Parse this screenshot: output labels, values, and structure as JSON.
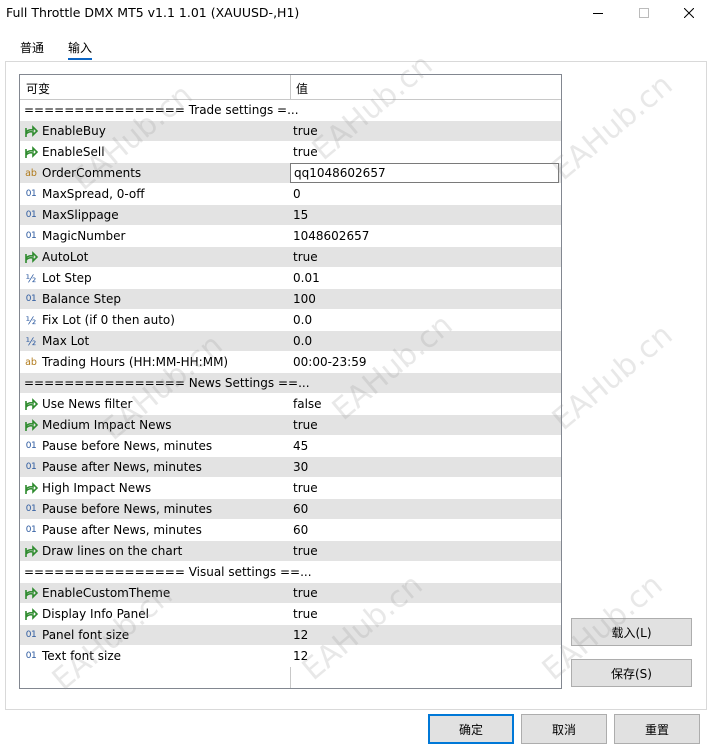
{
  "window": {
    "title": "Full Throttle DMX MT5 v1.1 1.01 (XAUUSD-,H1)",
    "minimize_icon": "minimize-icon",
    "maximize_icon": "maximize-icon",
    "close_icon": "close-icon"
  },
  "tabs": [
    {
      "label": "普通",
      "active": false
    },
    {
      "label": "输入",
      "active": true
    }
  ],
  "grid": {
    "col_variable": "可变",
    "col_value": "值",
    "rows": [
      {
        "type": "sep",
        "name": "================ Trade settings =..."
      },
      {
        "type": "bool",
        "icon": "arrow-icon",
        "name": "EnableBuy",
        "value": "true"
      },
      {
        "type": "bool",
        "icon": "arrow-icon",
        "name": "EnableSell",
        "value": "true"
      },
      {
        "type": "string",
        "icon": "ab-icon",
        "name": "OrderComments",
        "value": "qq1048602657",
        "editing": true
      },
      {
        "type": "int",
        "icon": "int-icon",
        "name": "MaxSpread, 0-off",
        "value": "0"
      },
      {
        "type": "int",
        "icon": "int-icon",
        "name": "MaxSlippage",
        "value": "15"
      },
      {
        "type": "int",
        "icon": "int-icon",
        "name": "MagicNumber",
        "value": "1048602657"
      },
      {
        "type": "bool",
        "icon": "arrow-icon",
        "name": "AutoLot",
        "value": "true"
      },
      {
        "type": "double",
        "icon": "fraction-icon",
        "name": "Lot Step",
        "value": "0.01"
      },
      {
        "type": "int",
        "icon": "int-icon",
        "name": "Balance Step",
        "value": "100"
      },
      {
        "type": "double",
        "icon": "fraction-icon",
        "name": "Fix Lot (if 0 then auto)",
        "value": "0.0"
      },
      {
        "type": "double",
        "icon": "fraction-icon",
        "name": "Max Lot",
        "value": "0.0"
      },
      {
        "type": "string",
        "icon": "ab-icon",
        "name": "Trading Hours (HH:MM-HH:MM)",
        "value": "00:00-23:59"
      },
      {
        "type": "sep",
        "name": "================ News Settings ==..."
      },
      {
        "type": "bool",
        "icon": "arrow-icon",
        "name": "Use News filter",
        "value": "false"
      },
      {
        "type": "bool",
        "icon": "arrow-icon",
        "name": "Medium Impact News",
        "value": "true"
      },
      {
        "type": "int",
        "icon": "int-icon",
        "name": "Pause before News, minutes",
        "value": "45"
      },
      {
        "type": "int",
        "icon": "int-icon",
        "name": "Pause after News, minutes",
        "value": "30"
      },
      {
        "type": "bool",
        "icon": "arrow-icon",
        "name": "High Impact News",
        "value": "true"
      },
      {
        "type": "int",
        "icon": "int-icon",
        "name": "Pause before News, minutes",
        "value": "60"
      },
      {
        "type": "int",
        "icon": "int-icon",
        "name": "Pause after News, minutes",
        "value": "60"
      },
      {
        "type": "bool",
        "icon": "arrow-icon",
        "name": "Draw lines on the chart",
        "value": "true"
      },
      {
        "type": "sep",
        "name": "================ Visual settings ==..."
      },
      {
        "type": "bool",
        "icon": "arrow-icon",
        "name": "EnableCustomTheme",
        "value": "true"
      },
      {
        "type": "bool",
        "icon": "arrow-icon",
        "name": "Display Info Panel",
        "value": "true"
      },
      {
        "type": "int",
        "icon": "int-icon",
        "name": "Panel font size",
        "value": "12"
      },
      {
        "type": "int",
        "icon": "int-icon",
        "name": "Text font size",
        "value": "12"
      }
    ]
  },
  "side_buttons": {
    "load": "载入(L)",
    "save": "保存(S)"
  },
  "bottom_buttons": {
    "ok": "确定",
    "cancel": "取消",
    "reset": "重置"
  },
  "watermark": "EAHub.cn",
  "colors": {
    "accent": "#0078d7",
    "row_alt": "#e3e3e3",
    "bool_icon": "#2e8b2e"
  }
}
